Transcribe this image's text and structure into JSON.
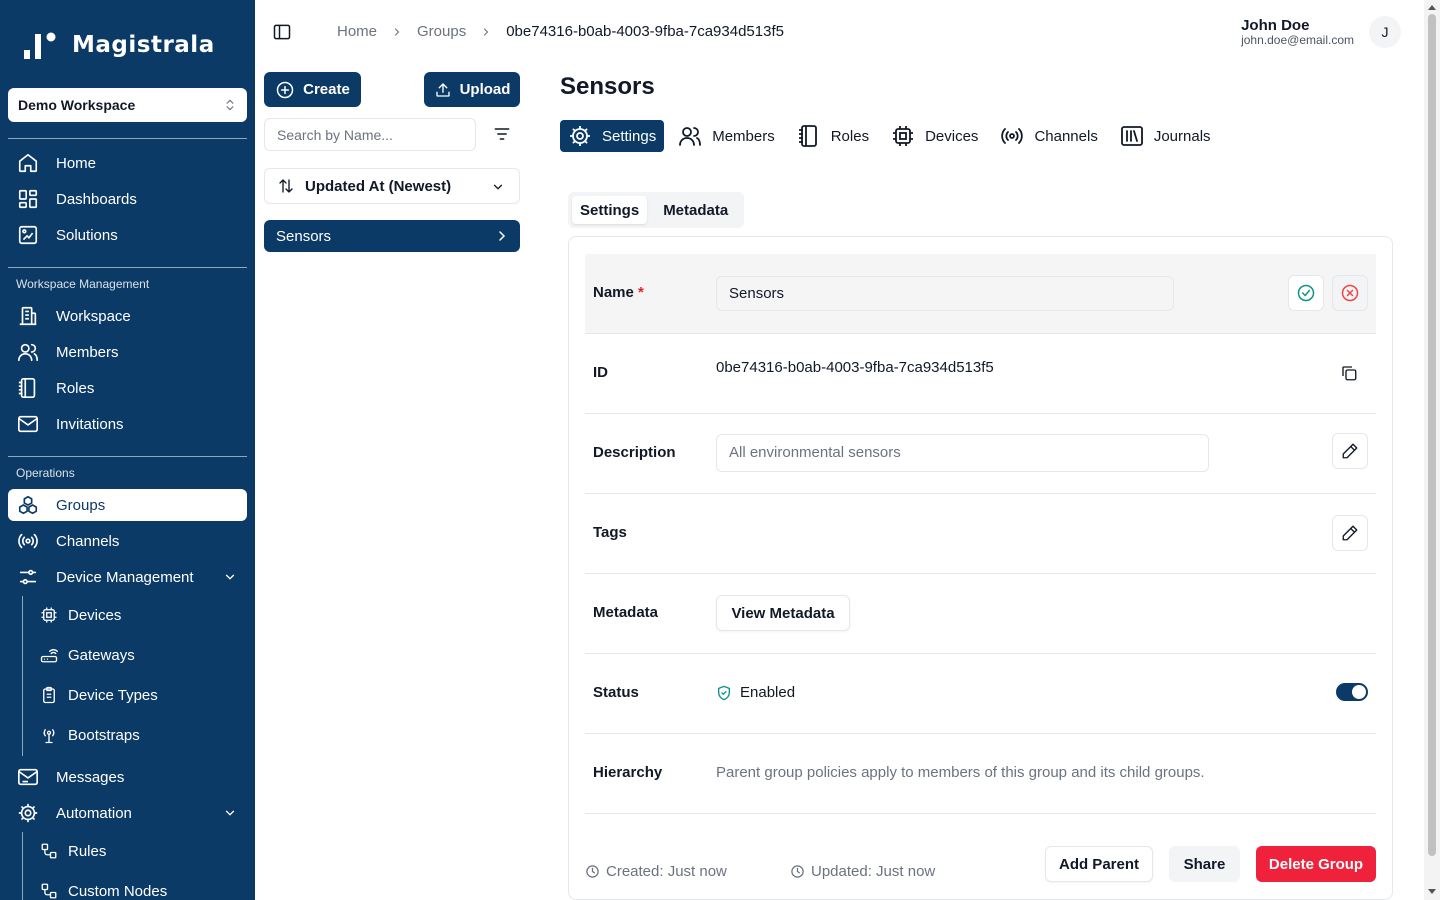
{
  "app": {
    "name": "Magistrala"
  },
  "workspace": {
    "selected": "Demo Workspace"
  },
  "sidebar": {
    "top_items": [
      {
        "label": "Home",
        "icon": "home-icon"
      },
      {
        "label": "Dashboards",
        "icon": "dashboard-icon"
      },
      {
        "label": "Solutions",
        "icon": "solutions-icon"
      }
    ],
    "workspace_section": "Workspace Management",
    "workspace_items": [
      {
        "label": "Workspace",
        "icon": "building-icon"
      },
      {
        "label": "Members",
        "icon": "users-icon"
      },
      {
        "label": "Roles",
        "icon": "notebook-icon"
      },
      {
        "label": "Invitations",
        "icon": "mail-icon"
      }
    ],
    "operations_section": "Operations",
    "operations_items": [
      {
        "label": "Groups",
        "icon": "groups-icon",
        "active": true
      },
      {
        "label": "Channels",
        "icon": "radio-icon"
      },
      {
        "label": "Device Management",
        "icon": "sliders-icon",
        "expanded": true
      }
    ],
    "device_sub_items": [
      {
        "label": "Devices",
        "icon": "cpu-icon"
      },
      {
        "label": "Gateways",
        "icon": "router-icon"
      },
      {
        "label": "Device Types",
        "icon": "clipboard-icon"
      },
      {
        "label": "Bootstraps",
        "icon": "antenna-icon"
      }
    ],
    "messages": {
      "label": "Messages",
      "icon": "mail-open-icon"
    },
    "automation": {
      "label": "Automation",
      "icon": "gear-icon",
      "expanded": true
    },
    "automation_sub_items": [
      {
        "label": "Rules",
        "icon": "workflow-icon"
      },
      {
        "label": "Custom Nodes",
        "icon": "workflow-icon"
      }
    ]
  },
  "breadcrumb": {
    "home": "Home",
    "groups": "Groups",
    "current": "0be74316-b0ab-4003-9fba-7ca934d513f5"
  },
  "user": {
    "name": "John Doe",
    "email": "john.doe@email.com",
    "initial": "J"
  },
  "list_panel": {
    "create_label": "Create",
    "upload_label": "Upload",
    "search_placeholder": "Search by Name...",
    "sort_label": "Updated At (Newest)",
    "items": [
      {
        "label": "Sensors",
        "selected": true
      }
    ]
  },
  "main": {
    "title": "Sensors",
    "tabs": [
      {
        "label": "Settings",
        "icon": "gear-icon",
        "active": true
      },
      {
        "label": "Members",
        "icon": "users-icon"
      },
      {
        "label": "Roles",
        "icon": "notebook-icon"
      },
      {
        "label": "Devices",
        "icon": "cpu-icon"
      },
      {
        "label": "Channels",
        "icon": "radio-icon"
      },
      {
        "label": "Journals",
        "icon": "library-icon"
      }
    ],
    "subtabs": [
      {
        "label": "Settings",
        "active": true
      },
      {
        "label": "Metadata"
      }
    ],
    "fields": {
      "name_label": "Name",
      "name_required_mark": "*",
      "name_value": "Sensors",
      "id_label": "ID",
      "id_value": "0be74316-b0ab-4003-9fba-7ca934d513f5",
      "description_label": "Description",
      "description_placeholder": "All environmental sensors",
      "tags_label": "Tags",
      "metadata_label": "Metadata",
      "view_metadata_label": "View Metadata",
      "status_label": "Status",
      "status_value": "Enabled",
      "status_enabled": true,
      "hierarchy_label": "Hierarchy",
      "hierarchy_text": "Parent group policies apply to members of this group and its child groups."
    },
    "footer": {
      "created": "Created: Just now",
      "updated": "Updated: Just now",
      "add_parent_label": "Add Parent",
      "share_label": "Share",
      "delete_label": "Delete Group"
    }
  },
  "colors": {
    "primary": "#0b3a66",
    "danger": "#f0213b",
    "success": "#0d9488"
  }
}
